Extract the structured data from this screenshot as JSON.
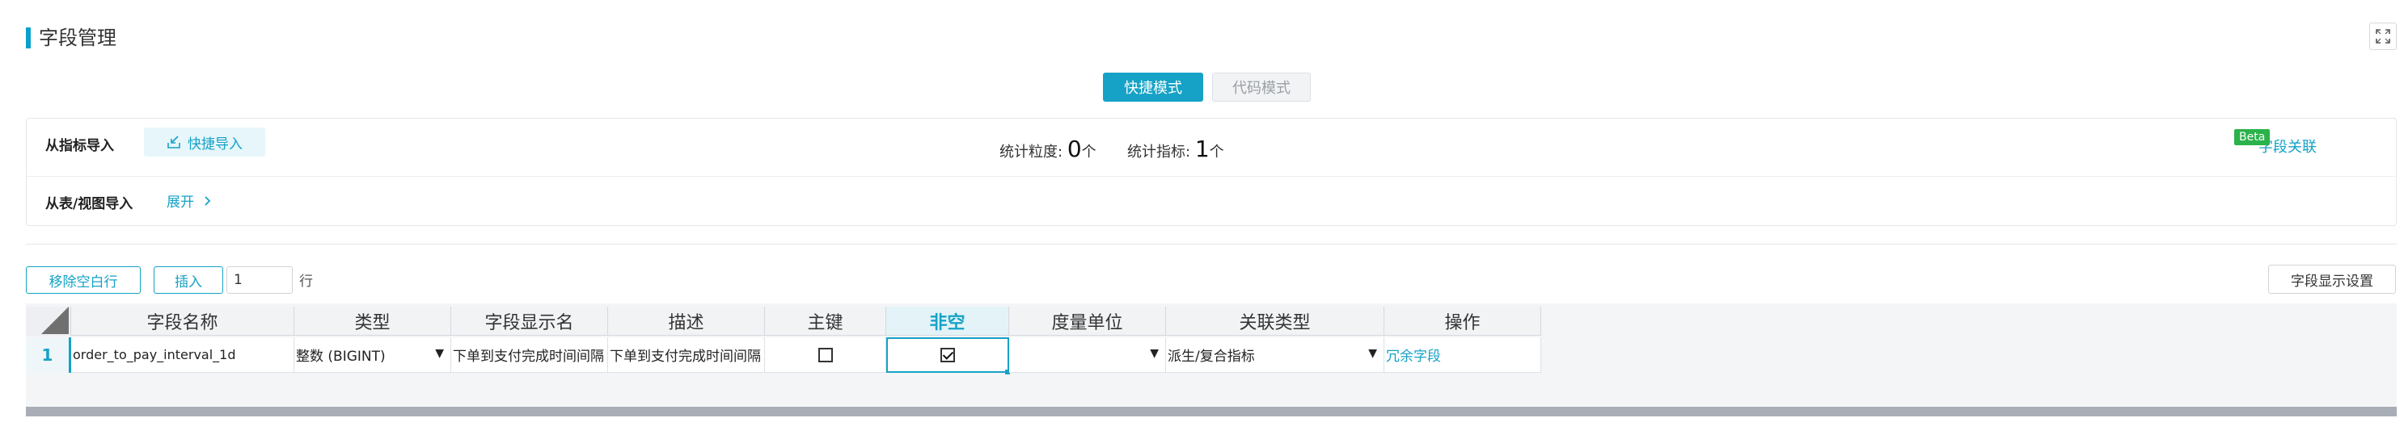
{
  "header": {
    "title": "字段管理",
    "fullscreen_icon": "expand-icon"
  },
  "mode": {
    "quick_label": "快捷模式",
    "code_label": "代码模式",
    "active": "quick"
  },
  "import_panel": {
    "from_metric_label": "从指标导入",
    "quick_import_label": "快捷导入",
    "quick_import_icon": "import-icon",
    "granularity_label": "统计粒度:",
    "granularity_value": "0",
    "granularity_unit": "个",
    "metric_label": "统计指标:",
    "metric_value": "1",
    "metric_unit": "个",
    "field_link_label": "字段关联",
    "beta_label": "Beta",
    "from_table_label": "从表/视图导入",
    "expand_label": "展开",
    "expand_icon": "chevron-right-icon"
  },
  "toolbar": {
    "remove_blank_label": "移除空白行",
    "insert_label": "插入",
    "insert_count": "1",
    "row_unit": "行",
    "display_setting_label": "字段显示设置"
  },
  "grid": {
    "columns": [
      "字段名称",
      "类型",
      "字段显示名",
      "描述",
      "主键",
      "非空",
      "度量单位",
      "关联类型",
      "操作"
    ],
    "active_column": "非空",
    "rows": [
      {
        "index": "1",
        "name": "order_to_pay_interval_1d",
        "type": "整数 (BIGINT)",
        "display_name": "下单到支付完成时间间隔",
        "description": "下单到支付完成时间间隔",
        "primary_key": false,
        "not_null": true,
        "unit": "",
        "relation_type": "派生/复合指标",
        "action": "冗余字段"
      }
    ]
  },
  "colors": {
    "accent": "#16a2c6",
    "beta": "#2bb24a"
  }
}
